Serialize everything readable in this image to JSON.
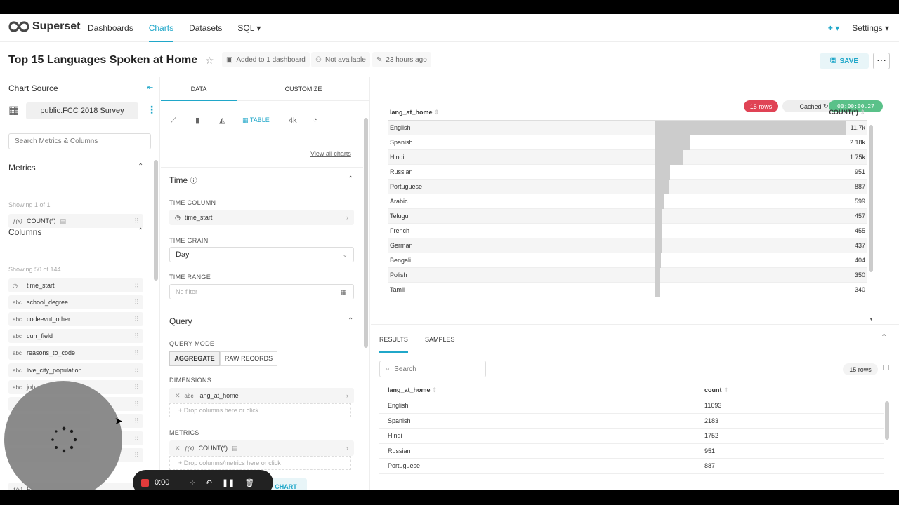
{
  "nav": {
    "brand": "Superset",
    "items": [
      "Dashboards",
      "Charts",
      "Datasets",
      "SQL ▾"
    ],
    "plus": "+ ▾",
    "settings": "Settings ▾"
  },
  "header": {
    "title": "Top 15 Languages Spoken at Home",
    "added": "Added to 1 dashboard",
    "owner": "Not available",
    "modified": "23 hours ago",
    "save": "SAVE",
    "more": "···"
  },
  "left": {
    "chart_source": "Chart Source",
    "dataset": "public.FCC 2018 Survey",
    "search_placeholder": "Search Metrics & Columns",
    "metrics_title": "Metrics",
    "metrics_showing": "Showing 1 of 1",
    "metric": "COUNT(*)",
    "columns_title": "Columns",
    "columns_showing": "Showing 50 of 144",
    "columns": [
      {
        "type": "time",
        "name": "time_start"
      },
      {
        "type": "abc",
        "name": "school_degree"
      },
      {
        "type": "abc",
        "name": "codeevnt_other"
      },
      {
        "type": "abc",
        "name": "curr_field"
      },
      {
        "type": "abc",
        "name": "reasons_to_code"
      },
      {
        "type": "abc",
        "name": "live_city_population"
      },
      {
        "type": "abc",
        "name": "job"
      }
    ],
    "last_item": "Et"
  },
  "mid": {
    "tab_data": "DATA",
    "tab_customize": "CUSTOMIZE",
    "table_label": "TABLE",
    "fourk": "4k",
    "view_all": "View all charts",
    "time_title": "Time",
    "time_column_lbl": "TIME COLUMN",
    "time_column": "time_start",
    "time_grain_lbl": "TIME GRAIN",
    "time_grain": "Day",
    "time_range_lbl": "TIME RANGE",
    "time_range": "No filter",
    "query_title": "Query",
    "query_mode_lbl": "QUERY MODE",
    "aggregate": "AGGREGATE",
    "raw": "RAW RECORDS",
    "dimensions_lbl": "DIMENSIONS",
    "dimension": "lang_at_home",
    "drop_columns": "Drop columns here or click",
    "metrics_lbl": "METRICS",
    "metric": "COUNT(*)",
    "drop_metrics": "Drop columns/metrics here or click",
    "update_chart": "CHART"
  },
  "right": {
    "rows_badge": "15 rows",
    "cached": "Cached",
    "timer": "00:00:00.27",
    "chart_headers": [
      "lang_at_home",
      "COUNT(*)"
    ],
    "results_tab": "RESULTS",
    "samples_tab": "SAMPLES",
    "search_placeholder": "Search",
    "rows_count": "15 rows",
    "result_headers": [
      "lang_at_home",
      "count"
    ]
  },
  "chart_data": {
    "type": "table",
    "columns": [
      "lang_at_home",
      "COUNT(*)"
    ],
    "max": 11693,
    "rows": [
      {
        "lang": "English",
        "label": "11.7k",
        "value": 11693
      },
      {
        "lang": "Spanish",
        "label": "2.18k",
        "value": 2183
      },
      {
        "lang": "Hindi",
        "label": "1.75k",
        "value": 1752
      },
      {
        "lang": "Russian",
        "label": "951",
        "value": 951
      },
      {
        "lang": "Portuguese",
        "label": "887",
        "value": 887
      },
      {
        "lang": "Arabic",
        "label": "599",
        "value": 599
      },
      {
        "lang": "Telugu",
        "label": "457",
        "value": 457
      },
      {
        "lang": "French",
        "label": "455",
        "value": 455
      },
      {
        "lang": "German",
        "label": "437",
        "value": 437
      },
      {
        "lang": "Bengali",
        "label": "404",
        "value": 404
      },
      {
        "lang": "Polish",
        "label": "350",
        "value": 350
      },
      {
        "lang": "Tamil",
        "label": "340",
        "value": 340
      }
    ]
  },
  "results_rows": [
    {
      "lang": "English",
      "count": "11693"
    },
    {
      "lang": "Spanish",
      "count": "2183"
    },
    {
      "lang": "Hindi",
      "count": "1752"
    },
    {
      "lang": "Russian",
      "count": "951"
    },
    {
      "lang": "Portuguese",
      "count": "887"
    }
  ],
  "recorder": {
    "time": "0:00"
  },
  "colors": {
    "accent": "#20a7c9",
    "rows_badge": "#e04355",
    "timer": "#5ac189"
  }
}
